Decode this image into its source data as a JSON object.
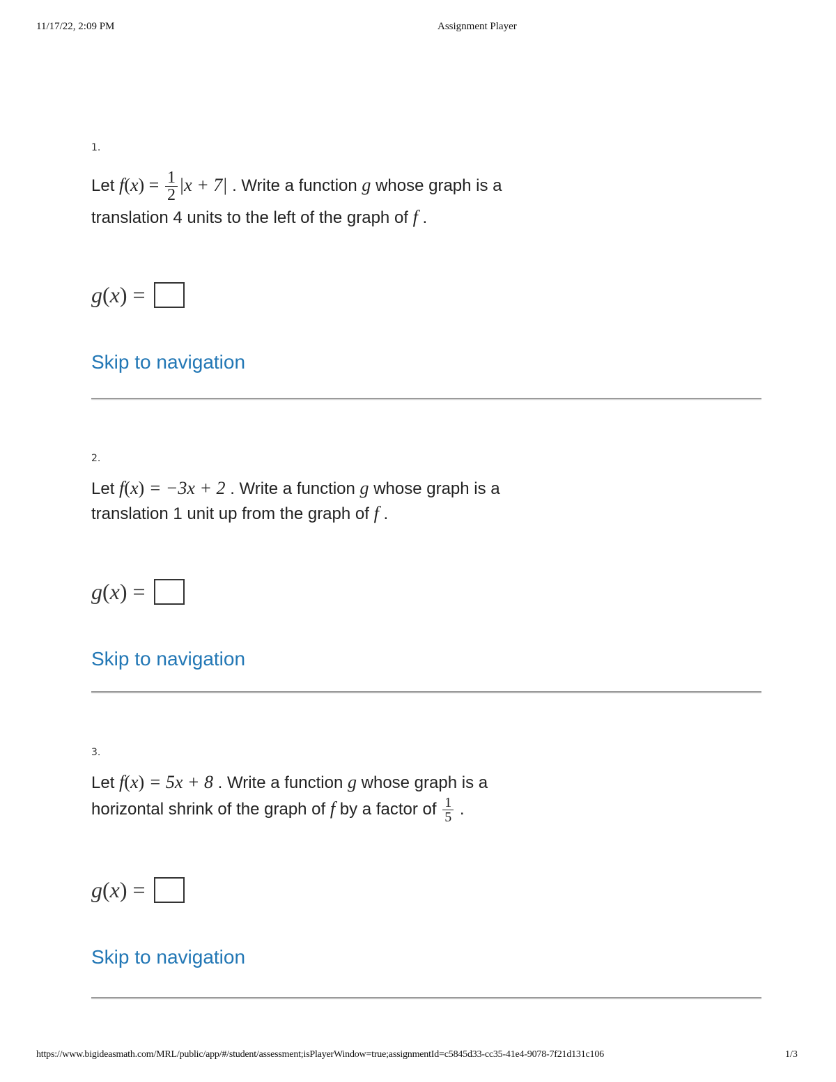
{
  "header": {
    "datetime": "11/17/22, 2:09 PM",
    "title": "Assignment Player"
  },
  "footer": {
    "url": "https://www.bigideasmath.com/MRL/public/app/#/student/assessment;isPlayerWindow=true;assignmentId=c5845d33-cc35-41e4-9078-7f21d131c106",
    "page": "1/3"
  },
  "common": {
    "let": "Let",
    "write_a_function": ". Write a function",
    "whose_graph": "whose graph is a",
    "answer_label_g": "g",
    "answer_label_x": "x",
    "skip_link": "Skip to navigation"
  },
  "questions": [
    {
      "number": "1.",
      "function_rhs_before": "|x + 7|",
      "fraction_num": "1",
      "fraction_den": "2",
      "line2": "translation 4 units to the left of the graph of",
      "line2_end": "."
    },
    {
      "number": "2.",
      "function_rhs": "= −3x + 2",
      "line2": "translation 1 unit up from the graph of",
      "line2_end": "."
    },
    {
      "number": "3.",
      "function_rhs": "= 5x + 8",
      "line2": "horizontal shrink of the graph of",
      "line2_mid": "by a factor of",
      "fraction_num": "1",
      "fraction_den": "5",
      "line2_end": "."
    }
  ]
}
